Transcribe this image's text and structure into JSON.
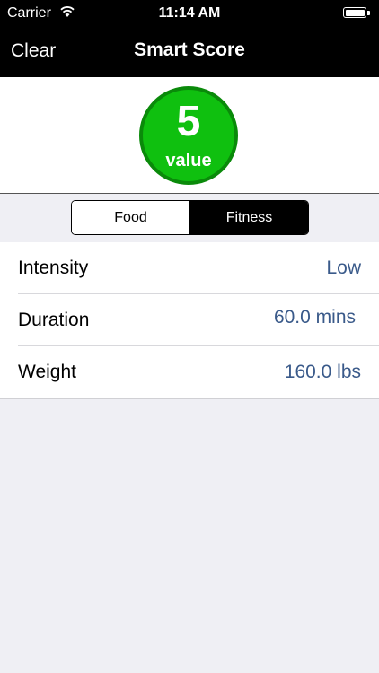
{
  "status_bar": {
    "carrier": "Carrier",
    "time": "11:14 AM",
    "wifi_icon": "wifi-icon",
    "battery_icon": "battery-icon"
  },
  "nav": {
    "clear_label": "Clear",
    "title": "Smart Score"
  },
  "score": {
    "number": "5",
    "label": "value",
    "color": "#0fc00f"
  },
  "segments": {
    "food_label": "Food",
    "fitness_label": "Fitness",
    "selected": "Fitness"
  },
  "rows": [
    {
      "label": "Intensity",
      "value": "Low"
    },
    {
      "label": "Duration",
      "value": "60.0 mins"
    },
    {
      "label": "Weight",
      "value": "160.0 lbs"
    }
  ],
  "colors": {
    "value_text": "#3a5a8a",
    "background": "#efeff4"
  }
}
